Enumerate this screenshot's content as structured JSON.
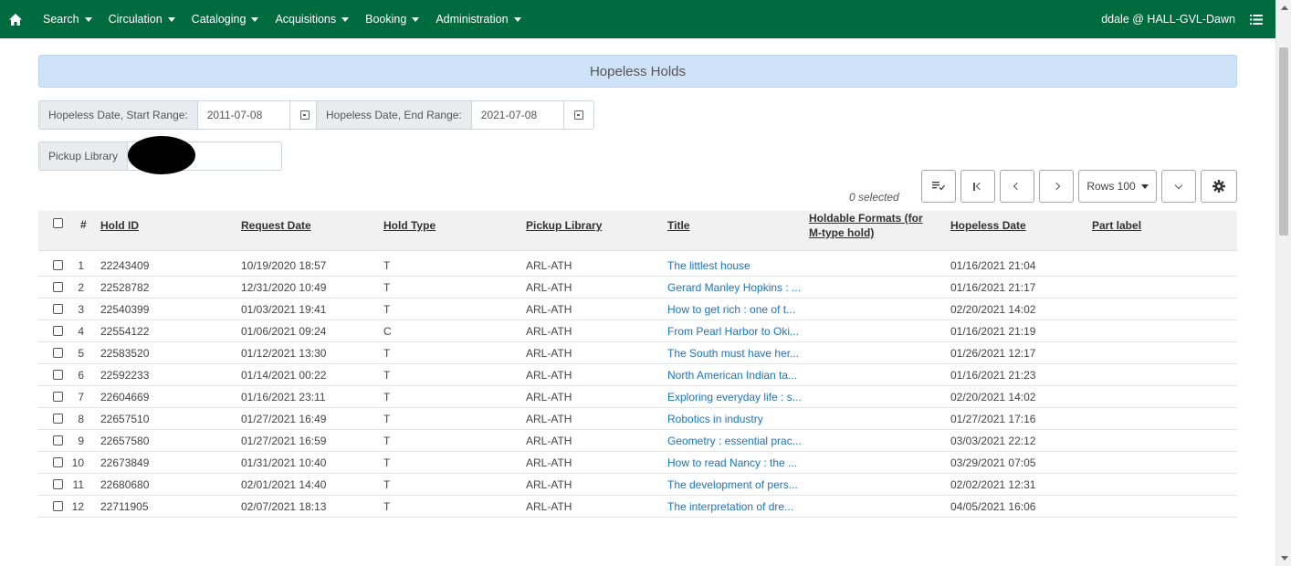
{
  "nav": {
    "menus": [
      "Search",
      "Circulation",
      "Cataloging",
      "Acquisitions",
      "Booking",
      "Administration"
    ],
    "user": "ddale @ HALL-GVL-Dawn"
  },
  "page_title": "Hopeless Holds",
  "filters": {
    "start_label": "Hopeless Date, Start Range:",
    "start_value": "2011-07-08",
    "end_label": "Hopeless Date, End Range:",
    "end_value": "2021-07-08",
    "pickup_label": "Pickup Library"
  },
  "toolbar": {
    "selected": "0 selected",
    "rows_label": "Rows 100"
  },
  "grid": {
    "columns": {
      "num": "#",
      "hold_id": "Hold ID",
      "request_date": "Request Date",
      "hold_type": "Hold Type",
      "pickup_library": "Pickup Library",
      "title": "Title",
      "holdable_formats_1": "Holdable Formats (for",
      "holdable_formats_2": "M-type hold)",
      "hopeless_date": "Hopeless Date",
      "part_label": "Part label"
    },
    "rows": [
      {
        "num": "1",
        "hold_id": "22243409",
        "request_date": "10/19/2020 18:57",
        "hold_type": "T",
        "pickup_library": "ARL-ATH",
        "title": "The littlest house",
        "hopeless_date": "01/16/2021 21:04"
      },
      {
        "num": "2",
        "hold_id": "22528782",
        "request_date": "12/31/2020 10:49",
        "hold_type": "T",
        "pickup_library": "ARL-ATH",
        "title": "Gerard Manley Hopkins : ...",
        "hopeless_date": "01/16/2021 21:17"
      },
      {
        "num": "3",
        "hold_id": "22540399",
        "request_date": "01/03/2021 19:41",
        "hold_type": "T",
        "pickup_library": "ARL-ATH",
        "title": "How to get rich : one of t...",
        "hopeless_date": "02/20/2021 14:02"
      },
      {
        "num": "4",
        "hold_id": "22554122",
        "request_date": "01/06/2021 09:24",
        "hold_type": "C",
        "pickup_library": "ARL-ATH",
        "title": "From Pearl Harbor to Oki...",
        "hopeless_date": "01/16/2021 21:19"
      },
      {
        "num": "5",
        "hold_id": "22583520",
        "request_date": "01/12/2021 13:30",
        "hold_type": "T",
        "pickup_library": "ARL-ATH",
        "title": "The South must have her...",
        "hopeless_date": "01/26/2021 12:17"
      },
      {
        "num": "6",
        "hold_id": "22592233",
        "request_date": "01/14/2021 00:22",
        "hold_type": "T",
        "pickup_library": "ARL-ATH",
        "title": "North American Indian ta...",
        "hopeless_date": "01/16/2021 21:23"
      },
      {
        "num": "7",
        "hold_id": "22604669",
        "request_date": "01/16/2021 23:11",
        "hold_type": "T",
        "pickup_library": "ARL-ATH",
        "title": "Exploring everyday life : s...",
        "hopeless_date": "02/20/2021 14:02"
      },
      {
        "num": "8",
        "hold_id": "22657510",
        "request_date": "01/27/2021 16:49",
        "hold_type": "T",
        "pickup_library": "ARL-ATH",
        "title": "Robotics in industry",
        "hopeless_date": "01/27/2021 17:16"
      },
      {
        "num": "9",
        "hold_id": "22657580",
        "request_date": "01/27/2021 16:59",
        "hold_type": "T",
        "pickup_library": "ARL-ATH",
        "title": "Geometry : essential prac...",
        "hopeless_date": "03/03/2021 22:12"
      },
      {
        "num": "10",
        "hold_id": "22673849",
        "request_date": "01/31/2021 10:40",
        "hold_type": "T",
        "pickup_library": "ARL-ATH",
        "title": "How to read Nancy : the ...",
        "hopeless_date": "03/29/2021 07:05"
      },
      {
        "num": "11",
        "hold_id": "22680680",
        "request_date": "02/01/2021 14:40",
        "hold_type": "T",
        "pickup_library": "ARL-ATH",
        "title": "The development of pers...",
        "hopeless_date": "02/02/2021 12:31"
      },
      {
        "num": "12",
        "hold_id": "22711905",
        "request_date": "02/07/2021 18:13",
        "hold_type": "T",
        "pickup_library": "ARL-ATH",
        "title": "The interpretation of dre...",
        "hopeless_date": "04/05/2021 16:06"
      }
    ]
  }
}
